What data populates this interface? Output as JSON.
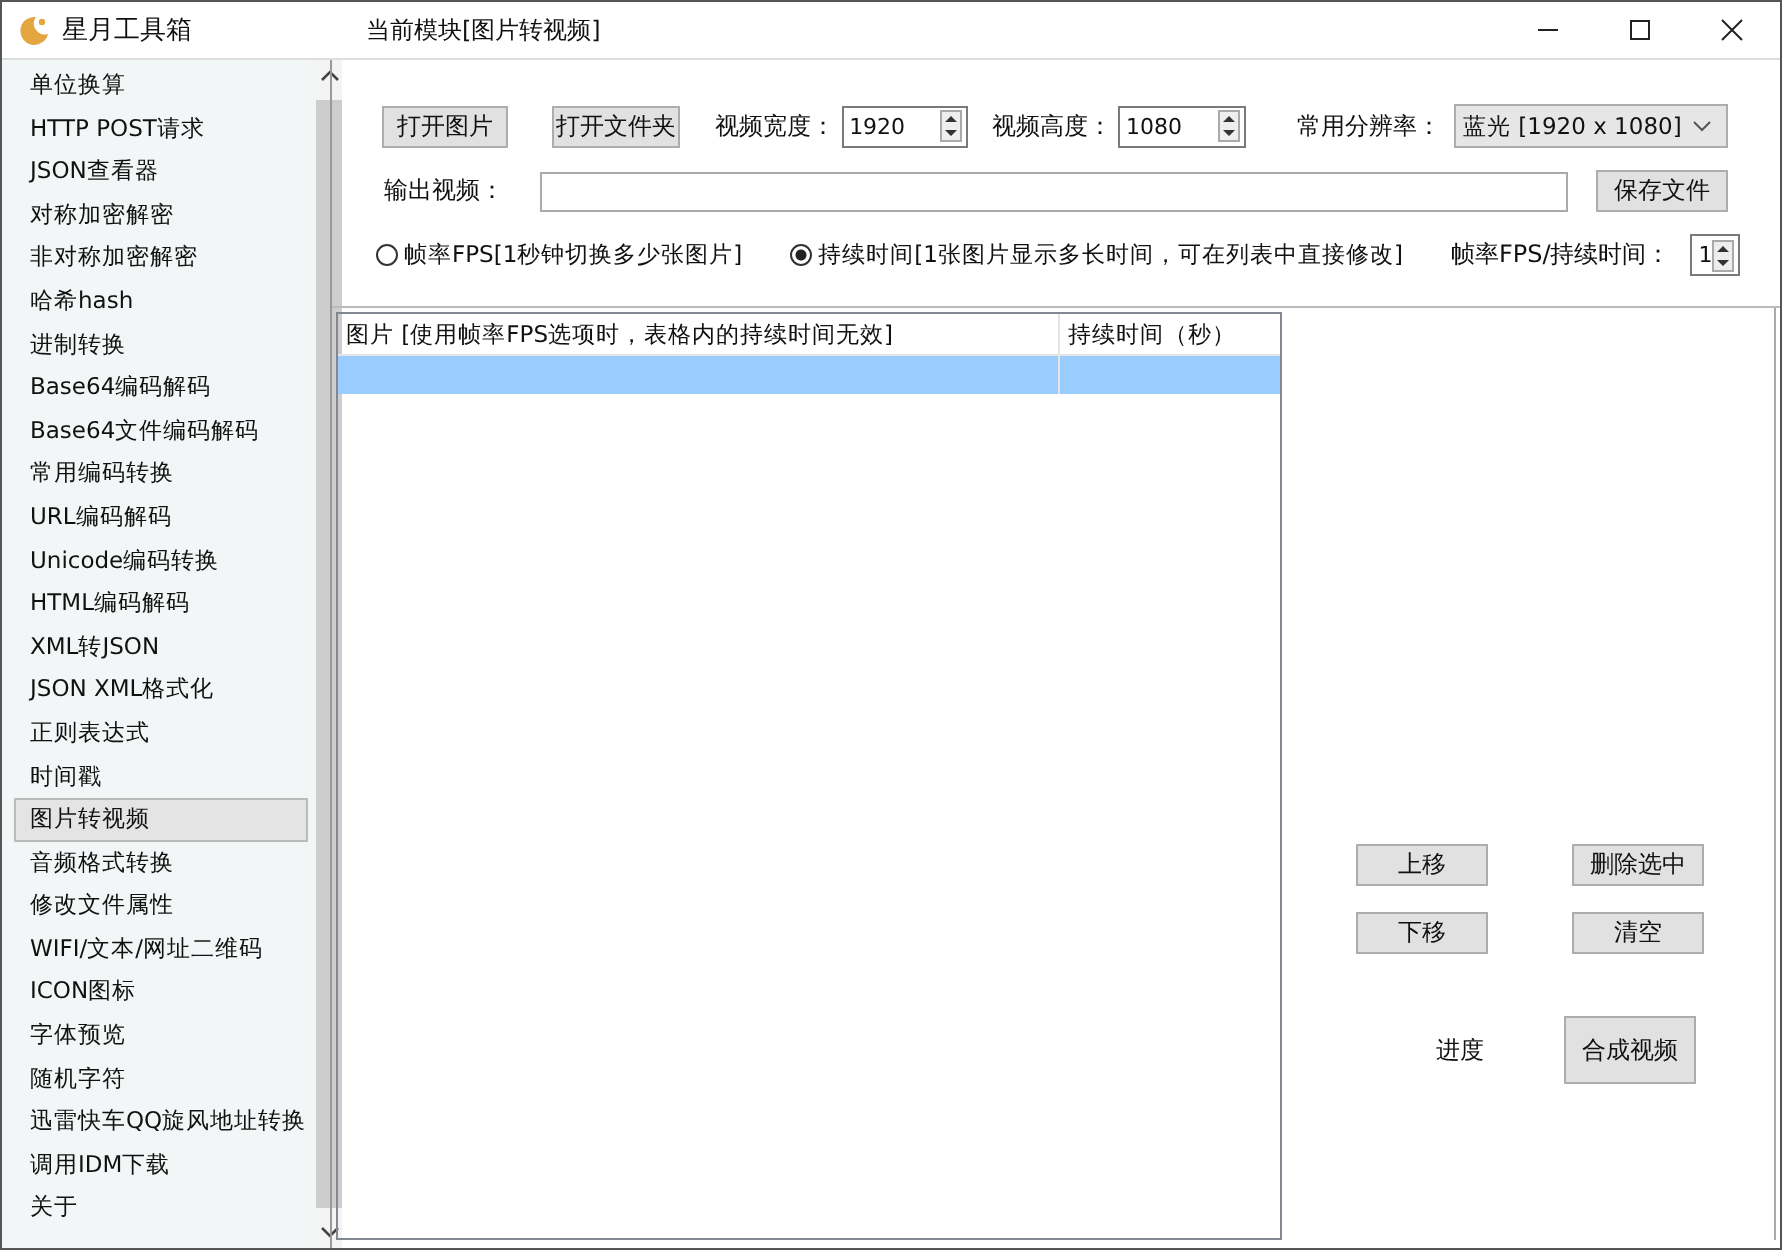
{
  "window": {
    "title": "星月工具箱",
    "module": "当前模块[图片转视频]"
  },
  "sidebar": {
    "items": [
      {
        "label": "单位换算",
        "selected": false
      },
      {
        "label": "HTTP POST请求",
        "selected": false
      },
      {
        "label": "JSON查看器",
        "selected": false
      },
      {
        "label": "对称加密解密",
        "selected": false
      },
      {
        "label": "非对称加密解密",
        "selected": false
      },
      {
        "label": "哈希hash",
        "selected": false
      },
      {
        "label": "进制转换",
        "selected": false
      },
      {
        "label": "Base64编码解码",
        "selected": false
      },
      {
        "label": "Base64文件编码解码",
        "selected": false
      },
      {
        "label": "常用编码转换",
        "selected": false
      },
      {
        "label": "URL编码解码",
        "selected": false
      },
      {
        "label": "Unicode编码转换",
        "selected": false
      },
      {
        "label": "HTML编码解码",
        "selected": false
      },
      {
        "label": "XML转JSON",
        "selected": false
      },
      {
        "label": "JSON XML格式化",
        "selected": false
      },
      {
        "label": "正则表达式",
        "selected": false
      },
      {
        "label": "时间戳",
        "selected": false
      },
      {
        "label": "图片转视频",
        "selected": true
      },
      {
        "label": "音频格式转换",
        "selected": false
      },
      {
        "label": "修改文件属性",
        "selected": false
      },
      {
        "label": "WIFI/文本/网址二维码",
        "selected": false
      },
      {
        "label": "ICON图标",
        "selected": false
      },
      {
        "label": "字体预览",
        "selected": false
      },
      {
        "label": "随机字符",
        "selected": false
      },
      {
        "label": "迅雷快车QQ旋风地址转换",
        "selected": false
      },
      {
        "label": "调用IDM下载",
        "selected": false
      },
      {
        "label": "关于",
        "selected": false
      }
    ]
  },
  "toolbar": {
    "open_image": "打开图片",
    "open_folder": "打开文件夹",
    "width": {
      "label": "视频宽度：",
      "value": "1920"
    },
    "height": {
      "label": "视频高度：",
      "value": "1080"
    },
    "resolution": {
      "label": "常用分辨率：",
      "value": "蓝光 [1920 x 1080]"
    }
  },
  "output": {
    "label": "输出视频：",
    "save": "保存文件"
  },
  "mode_options": [
    {
      "label": "帧率FPS[1秒钟切换多少张图片]",
      "selected": false
    },
    {
      "label": "持续时间[1张图片显示多长时间，可在列表中直接修改]",
      "selected": true
    }
  ],
  "rate": {
    "label": "帧率FPS/持续时间：",
    "value": "1"
  },
  "table": {
    "columns": [
      "图片  [使用帧率FPS选项时，表格内的持续时间无效]",
      "持续时间（秒）"
    ],
    "rows": [
      {
        "selected": true
      }
    ]
  },
  "actions": [
    "上移",
    "删除选中",
    "下移",
    "清空"
  ],
  "progress_label": "进度",
  "compose": "合成视频"
}
